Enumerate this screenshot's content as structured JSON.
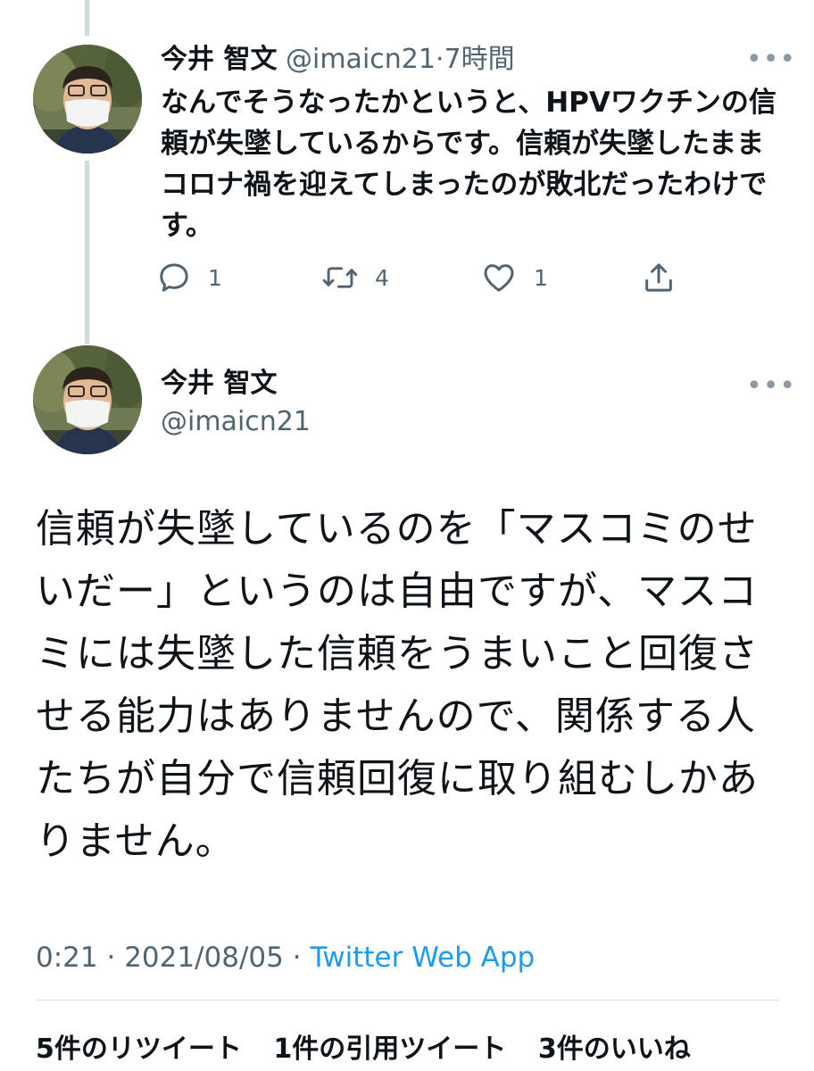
{
  "reply_tweet": {
    "author_name": "今井 智文",
    "handle": "@imaicn21",
    "separator": "·",
    "time": "7時間",
    "text": "なんでそうなったかというと、HPVワクチンの信頼が失墜しているからです。信頼が失墜したままコロナ禍を迎えてしまったのが敗北だったわけです。",
    "replies": "1",
    "retweets": "4",
    "likes": "1",
    "more_icon": "more-horizontal-icon"
  },
  "main_tweet": {
    "author_name": "今井 智文",
    "handle": "@imaicn21",
    "text": "信頼が失墜しているのを「マスコミのせいだー」というのは自由ですが、マスコミには失墜した信頼をうまいこと回復させる能力はありませんので、関係する人たちが自分で信頼回復に取り組むしかありません。",
    "time": "0:21",
    "date": "2021/08/05",
    "separator": "·",
    "source": "Twitter Web App",
    "stats": {
      "retweets_count": "5",
      "retweets_label": "件のリツイート",
      "quotes_count": "1",
      "quotes_label": "件の引用ツイート",
      "likes_count": "3",
      "likes_label": "件のいいね"
    }
  },
  "colors": {
    "link": "#1d9bf0",
    "secondary_text": "#536471",
    "thread_line": "#cfd9de"
  }
}
